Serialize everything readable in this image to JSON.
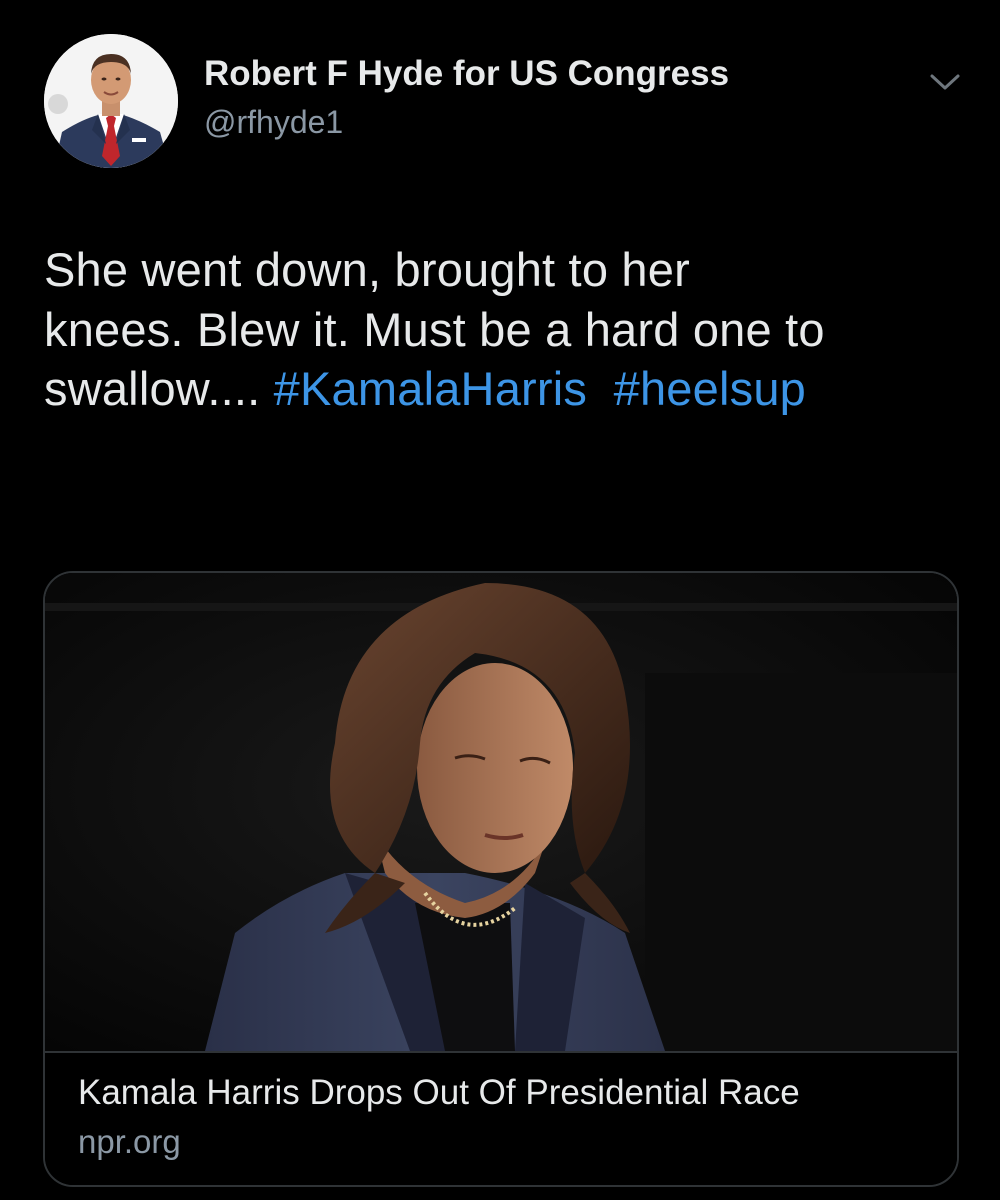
{
  "author": {
    "display_name": "Robert F Hyde for US Congress",
    "handle": "@rfhyde1"
  },
  "tweet": {
    "line1": "She went down, brought to her",
    "line2": "knees. Blew it. Must be a hard one to",
    "line3_prefix": "swallow....",
    "hashtags": [
      "#KamalaHarris",
      "#heelsup"
    ]
  },
  "link_card": {
    "title": "Kamala Harris Drops Out Of Presidential Race",
    "domain": "npr.org"
  },
  "icons": {
    "menu": "chevron-down-icon"
  },
  "colors": {
    "background": "#000000",
    "text": "#e7e9ea",
    "secondary_text": "#8b98a5",
    "hashtag": "#3d95e6",
    "border": "#2f3336"
  }
}
